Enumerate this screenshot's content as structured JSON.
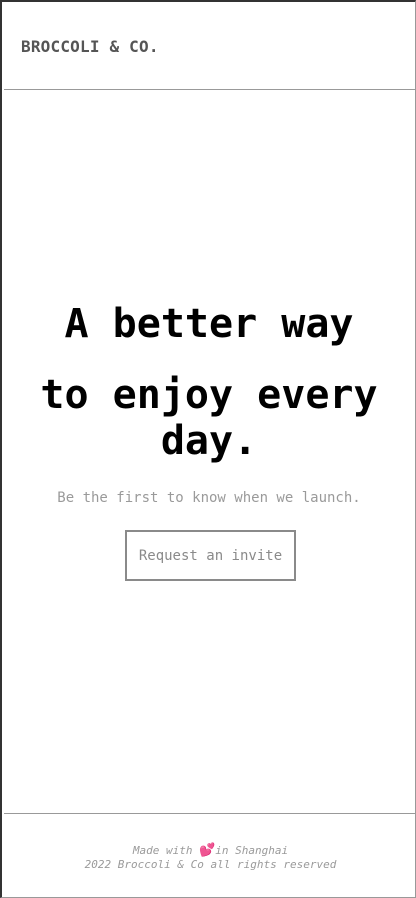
{
  "header": {
    "brand": "BROCCOLI & CO."
  },
  "hero": {
    "headline_line1": "A better way",
    "headline_line2": "to enjoy every day.",
    "subtitle": "Be the first to know when we launch.",
    "cta_label": "Request an invite"
  },
  "footer": {
    "made_with_prefix": "Made with",
    "heart": "💕",
    "made_with_suffix": "in Shanghai",
    "copyright": "2022 Broccoli & Co all rights reserved"
  },
  "colors": {
    "text_muted": "#9a9a9a",
    "heart": "#e0489a",
    "border": "#999999"
  }
}
